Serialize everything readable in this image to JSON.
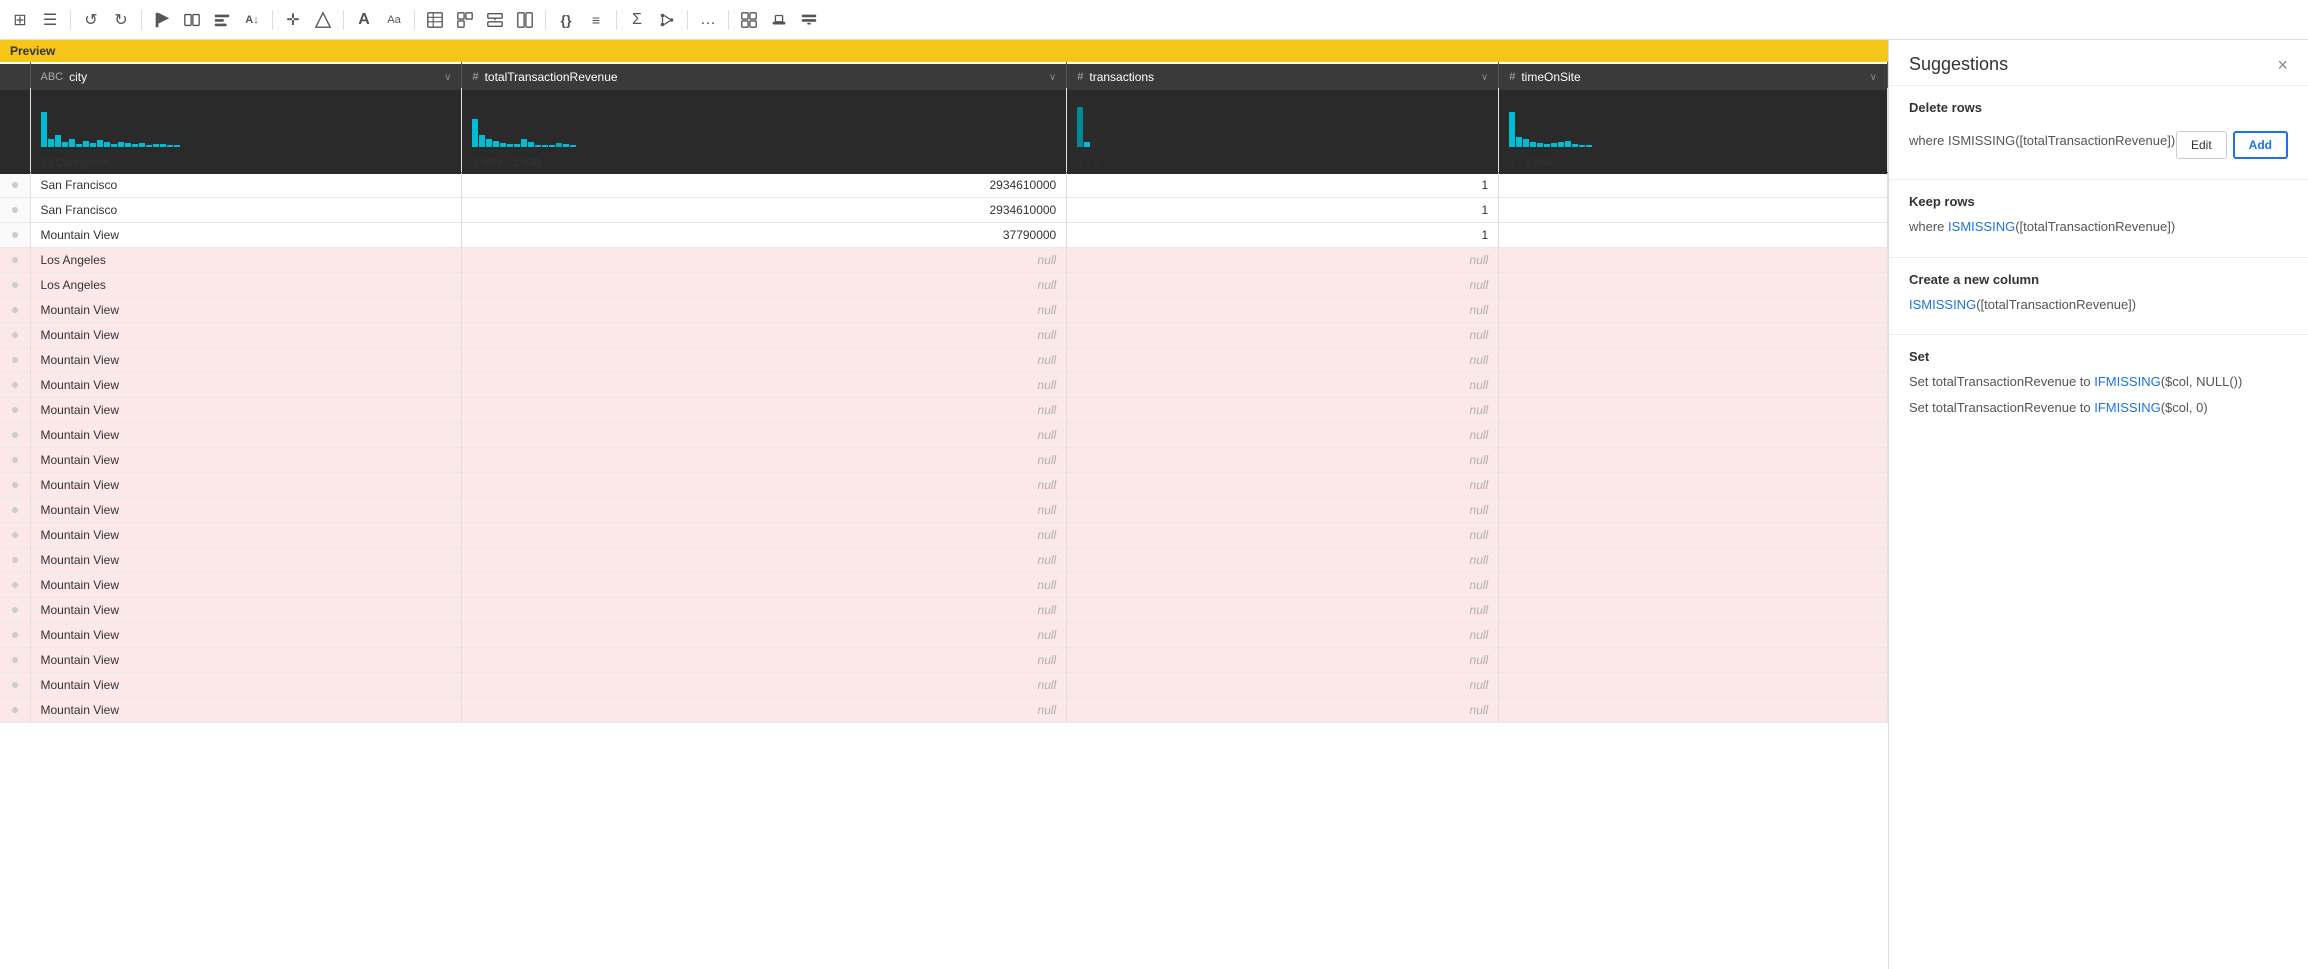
{
  "toolbar": {
    "icons": [
      {
        "name": "grid-icon",
        "symbol": "⊞"
      },
      {
        "name": "menu-icon",
        "symbol": "☰"
      },
      {
        "name": "undo-icon",
        "symbol": "↺"
      },
      {
        "name": "redo-icon",
        "symbol": "↻"
      },
      {
        "name": "flag-icon",
        "symbol": "⚑"
      },
      {
        "name": "compare-icon",
        "symbol": "⇄"
      },
      {
        "name": "arrange-icon",
        "symbol": "▤"
      },
      {
        "name": "sort-icon",
        "symbol": "A↓"
      },
      {
        "name": "move-icon",
        "symbol": "✛"
      },
      {
        "name": "transform-icon",
        "symbol": "⬡"
      },
      {
        "name": "text-icon",
        "symbol": "A"
      },
      {
        "name": "format-icon",
        "symbol": "Aa"
      },
      {
        "name": "table-icon",
        "symbol": "⊞"
      },
      {
        "name": "merge-icon",
        "symbol": "⊟"
      },
      {
        "name": "curly-icon",
        "symbol": "{}"
      },
      {
        "name": "filter-icon",
        "symbol": "≡"
      },
      {
        "name": "sigma-icon",
        "symbol": "Σ"
      },
      {
        "name": "branch-icon",
        "symbol": "⑂"
      },
      {
        "name": "more-icon",
        "symbol": "…"
      },
      {
        "name": "view-icon",
        "symbol": "⊡"
      },
      {
        "name": "stamp-icon",
        "symbol": "⊕"
      },
      {
        "name": "layout-icon",
        "symbol": "⊟"
      }
    ]
  },
  "preview_banner": "Preview",
  "suggestions": {
    "title": "Suggestions",
    "close_label": "×",
    "sections": [
      {
        "id": "delete-rows",
        "title": "Delete rows",
        "items": [
          {
            "text_prefix": "where ",
            "link_text": "ISMISSING",
            "text_suffix": "([totalTransactionRevenue])",
            "show_buttons": true
          }
        ]
      },
      {
        "id": "keep-rows",
        "title": "Keep rows",
        "items": [
          {
            "text_prefix": "where ",
            "link_text": "ISMISSING",
            "text_suffix": "([totalTransactionRevenue])",
            "show_buttons": false
          }
        ]
      },
      {
        "id": "create-column",
        "title": "Create a new column",
        "items": [
          {
            "text_prefix": "",
            "link_text": "ISMISSING",
            "text_suffix": "([totalTransactionRevenue])",
            "show_buttons": false
          }
        ]
      },
      {
        "id": "set",
        "title": "Set",
        "items": [
          {
            "text_prefix": "Set totalTransactionRevenue to ",
            "link_text": "IFMISSING",
            "text_suffix": "($col, NULL())",
            "show_buttons": false
          },
          {
            "text_prefix": "Set totalTransactionRevenue to ",
            "link_text": "IFMISSING",
            "text_suffix": "($col, 0)",
            "show_buttons": false
          }
        ]
      }
    ],
    "edit_label": "Edit",
    "add_label": "Add"
  },
  "table": {
    "columns": [
      {
        "id": "city",
        "label": "city",
        "type": "ABC",
        "width": "200"
      },
      {
        "id": "totalTransactionRevenue",
        "label": "totalTransactionRevenue",
        "type": "#",
        "width": "280"
      },
      {
        "id": "transactions",
        "label": "transactions",
        "type": "#",
        "width": "200"
      },
      {
        "id": "timeOnSite",
        "label": "timeOnSite",
        "type": "#",
        "width": "180"
      }
    ],
    "stats": [
      {
        "col": "city",
        "value": "53 Categories"
      },
      {
        "col": "totalTransactionRevenue",
        "value": "3.99M - 2.93B"
      },
      {
        "col": "transactions",
        "value": "1 - 2"
      },
      {
        "col": "timeOnSite",
        "value": "1 - 5.56k"
      }
    ],
    "rows": [
      {
        "type": "normal",
        "city": "San Francisco",
        "totalTransactionRevenue": "2934610000",
        "transactions": "1",
        "timeOnSite": ""
      },
      {
        "type": "normal",
        "city": "San Francisco",
        "totalTransactionRevenue": "2934610000",
        "transactions": "1",
        "timeOnSite": ""
      },
      {
        "type": "normal",
        "city": "Mountain View",
        "totalTransactionRevenue": "37790000",
        "transactions": "1",
        "timeOnSite": ""
      },
      {
        "type": "highlight",
        "city": "Los Angeles",
        "totalTransactionRevenue": "null",
        "transactions": "null",
        "timeOnSite": ""
      },
      {
        "type": "highlight",
        "city": "Los Angeles",
        "totalTransactionRevenue": "null",
        "transactions": "null",
        "timeOnSite": ""
      },
      {
        "type": "highlight",
        "city": "Mountain View",
        "totalTransactionRevenue": "null",
        "transactions": "null",
        "timeOnSite": ""
      },
      {
        "type": "highlight",
        "city": "Mountain View",
        "totalTransactionRevenue": "null",
        "transactions": "null",
        "timeOnSite": ""
      },
      {
        "type": "highlight",
        "city": "Mountain View",
        "totalTransactionRevenue": "null",
        "transactions": "null",
        "timeOnSite": ""
      },
      {
        "type": "highlight",
        "city": "Mountain View",
        "totalTransactionRevenue": "null",
        "transactions": "null",
        "timeOnSite": ""
      },
      {
        "type": "highlight",
        "city": "Mountain View",
        "totalTransactionRevenue": "null",
        "transactions": "null",
        "timeOnSite": ""
      },
      {
        "type": "highlight",
        "city": "Mountain View",
        "totalTransactionRevenue": "null",
        "transactions": "null",
        "timeOnSite": ""
      },
      {
        "type": "highlight",
        "city": "Mountain View",
        "totalTransactionRevenue": "null",
        "transactions": "null",
        "timeOnSite": ""
      },
      {
        "type": "highlight",
        "city": "Mountain View",
        "totalTransactionRevenue": "null",
        "transactions": "null",
        "timeOnSite": ""
      },
      {
        "type": "highlight",
        "city": "Mountain View",
        "totalTransactionRevenue": "null",
        "transactions": "null",
        "timeOnSite": ""
      },
      {
        "type": "highlight",
        "city": "Mountain View",
        "totalTransactionRevenue": "null",
        "transactions": "null",
        "timeOnSite": ""
      },
      {
        "type": "highlight",
        "city": "Mountain View",
        "totalTransactionRevenue": "null",
        "transactions": "null",
        "timeOnSite": ""
      },
      {
        "type": "highlight",
        "city": "Mountain View",
        "totalTransactionRevenue": "null",
        "transactions": "null",
        "timeOnSite": ""
      },
      {
        "type": "highlight",
        "city": "Mountain View",
        "totalTransactionRevenue": "null",
        "transactions": "null",
        "timeOnSite": ""
      },
      {
        "type": "highlight",
        "city": "Mountain View",
        "totalTransactionRevenue": "null",
        "transactions": "null",
        "timeOnSite": ""
      },
      {
        "type": "highlight",
        "city": "Mountain View",
        "totalTransactionRevenue": "null",
        "transactions": "null",
        "timeOnSite": ""
      },
      {
        "type": "highlight",
        "city": "Mountain View",
        "totalTransactionRevenue": "null",
        "transactions": "null",
        "timeOnSite": ""
      },
      {
        "type": "highlight",
        "city": "Mountain View",
        "totalTransactionRevenue": "null",
        "transactions": "null",
        "timeOnSite": ""
      }
    ]
  }
}
